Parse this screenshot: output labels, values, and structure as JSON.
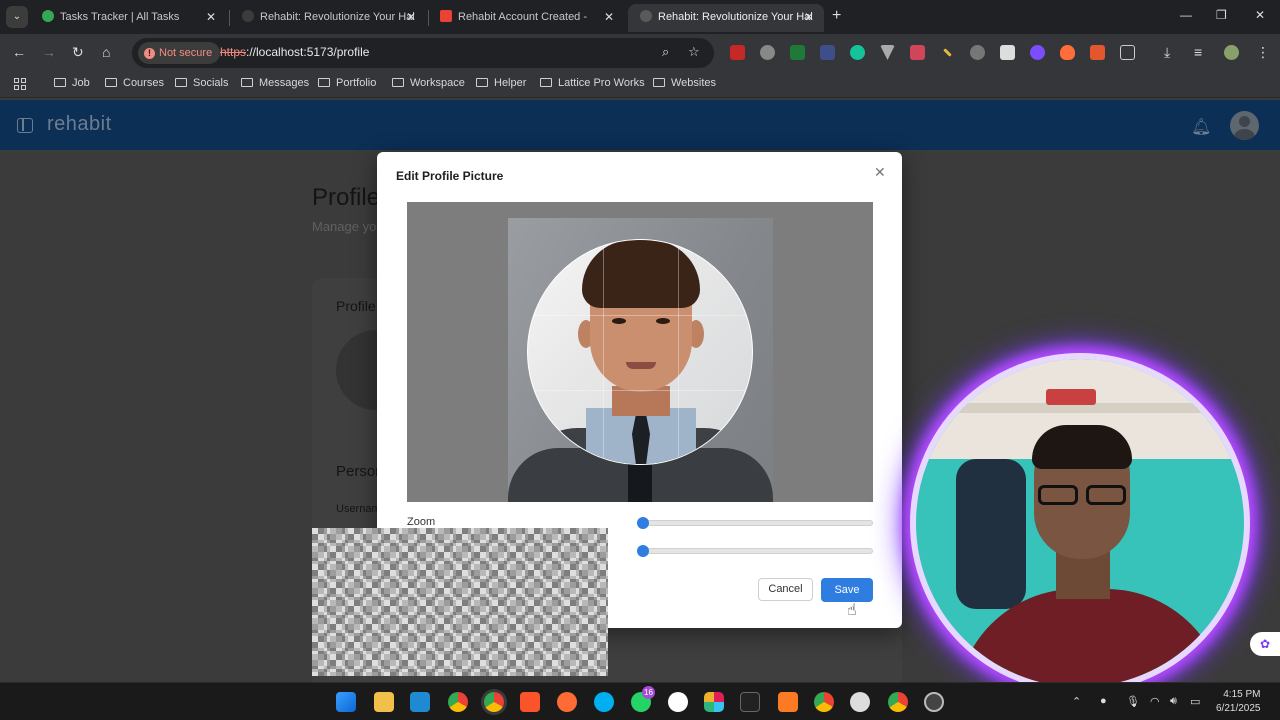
{
  "browser": {
    "tabs": [
      {
        "title": "Tasks Tracker | All Tasks",
        "favicon_color": "#34a853",
        "active": false
      },
      {
        "title": "Rehabit: Revolutionize Your Hal",
        "favicon_color": "#3c3c3c",
        "active": false
      },
      {
        "title": "Rehabit Account Created - ",
        "favicon_color": "#ea4335",
        "active": false
      },
      {
        "title": "Rehabit: Revolutionize Your Hal",
        "favicon_color": "#3c3c3c",
        "active": true
      }
    ],
    "new_tab_symbol": "+",
    "window_controls": {
      "minimize": "—",
      "maximize": "❐",
      "close": "✕"
    },
    "security_label": "Not secure",
    "url_scheme": "https",
    "url_rest": "://localhost:5173/profile",
    "bookmarks": [
      "Job",
      "Courses",
      "Socials",
      "Messages",
      "Portfolio",
      "Workspace",
      "Helper",
      "Lattice Pro Works",
      "Websites"
    ]
  },
  "app": {
    "logo": "rehabit",
    "page_title": "Profile",
    "page_subtitle": "Manage yo",
    "card_heading": "Profile",
    "section_heading": "Person",
    "field_label": "Usernam"
  },
  "modal": {
    "title": "Edit Profile Picture",
    "close_symbol": "✕",
    "zoom_label": "Zoom",
    "zoom_value": 0,
    "rotation_value": 0,
    "cancel_label": "Cancel",
    "save_label": "Save"
  },
  "taskbar": {
    "whatsapp_badge": "16",
    "time": "4:15 PM",
    "date": "6/21/2025"
  },
  "colors": {
    "accent": "#2f7de1",
    "appbar": "#0c2f55",
    "webcam_ring": "#b84cff"
  }
}
